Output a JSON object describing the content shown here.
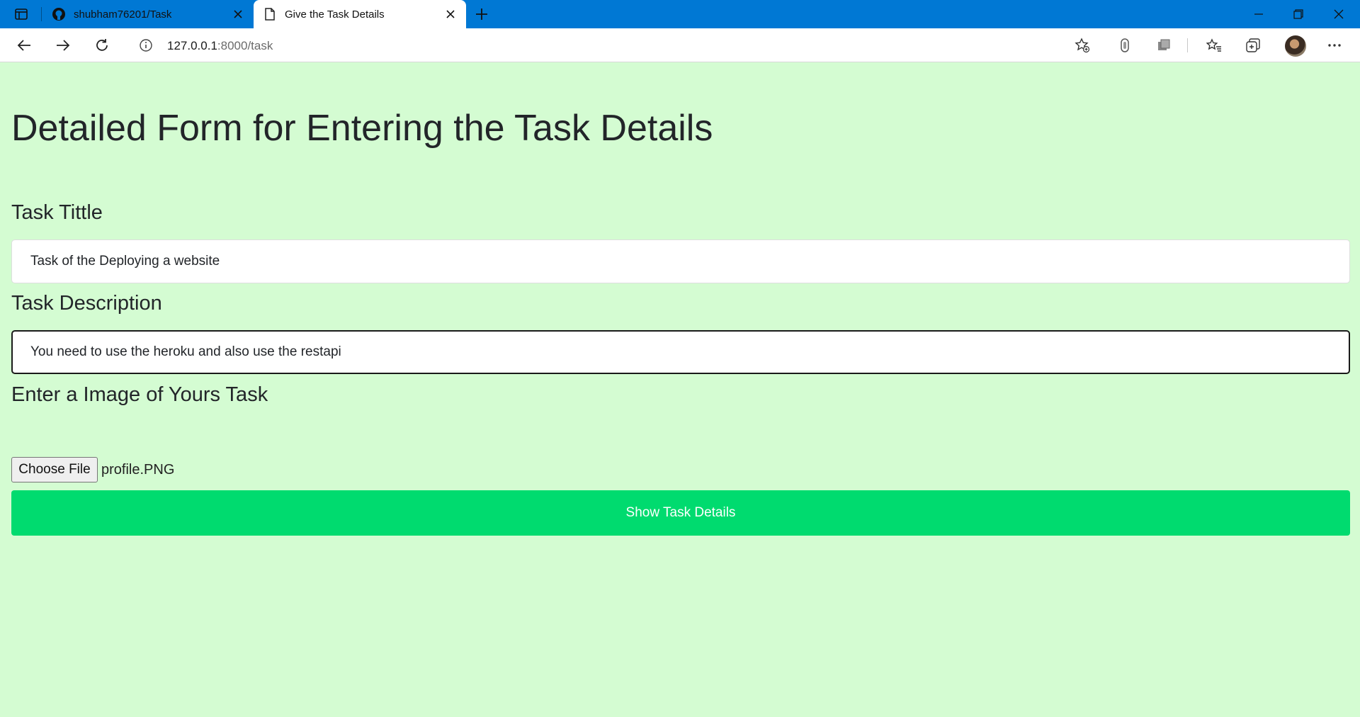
{
  "browser": {
    "tabs": [
      {
        "title": "shubham76201/Task",
        "icon": "github-icon",
        "active": false
      },
      {
        "title": "Give the Task Details",
        "icon": "page-icon",
        "active": true
      }
    ],
    "address": {
      "host": "127.0.0.1",
      "path": ":8000/task"
    },
    "accent": "#0078d4"
  },
  "page": {
    "title": "Detailed Form for Entering the Task Details",
    "task_title_label": "Task Tittle",
    "task_title_value": "Task of the Deploying a website",
    "task_desc_label": "Task Description",
    "task_desc_value": "You need to use the heroku and also use the restapi",
    "image_label": "Enter a Image of Yours Task",
    "file_button_label": "Choose File",
    "file_name": "profile.PNG",
    "submit_label": "Show Task Details",
    "background": "#d4fcd2",
    "button_color": "#00db6f"
  }
}
